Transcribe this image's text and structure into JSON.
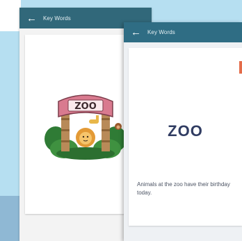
{
  "back_screen": {
    "title": "Key Words",
    "back_icon": "arrow-left-icon",
    "image": {
      "sign_text": "ZOO"
    }
  },
  "front_screen": {
    "title": "Key Words",
    "back_icon": "arrow-left-icon",
    "word": "ZOO",
    "sentence": "Animals at the zoo have their birthday today."
  },
  "colors": {
    "appbar": "#2f6d84",
    "background": "#b6dff1",
    "word_text": "#303c62"
  }
}
